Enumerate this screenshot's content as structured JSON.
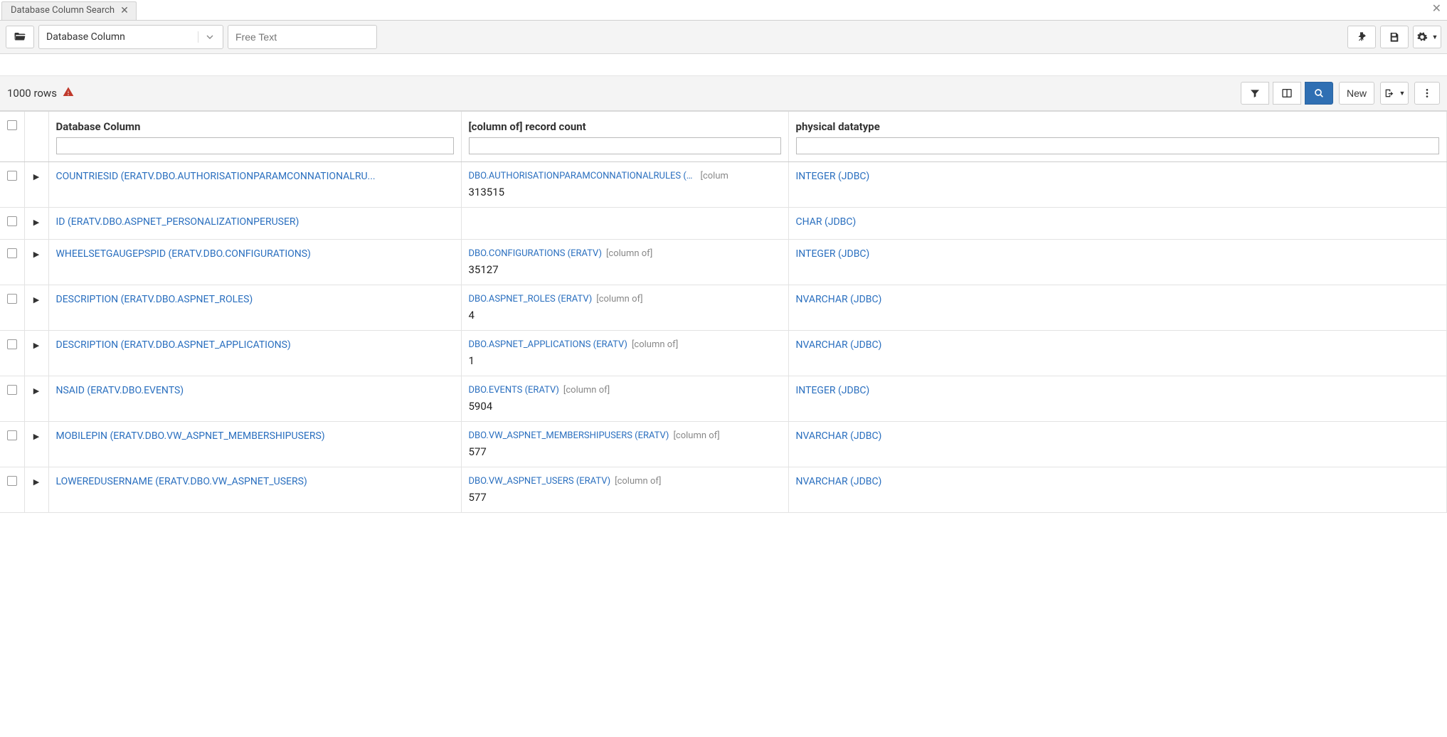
{
  "tab": {
    "title": "Database Column Search"
  },
  "toolbar": {
    "searchTypeSelected": "Database Column",
    "freeTextPlaceholder": "Free Text"
  },
  "results": {
    "rowCountLabel": "1000 rows",
    "newButtonLabel": "New"
  },
  "table": {
    "columns": {
      "dbColumn": "Database Column",
      "recordCount": "[column of] record count",
      "datatype": "physical datatype"
    },
    "rows": [
      {
        "dbColumn": "COUNTRIESID (ERATV.DBO.AUTHORISATIONPARAMCONNATIONALRU...",
        "recLink": "DBO.AUTHORISATIONPARAMCONNATIONALRULES (ERATV)",
        "recNote": "[colum",
        "count": "313515",
        "datatype": "INTEGER (JDBC)"
      },
      {
        "dbColumn": "ID (ERATV.DBO.ASPNET_PERSONALIZATIONPERUSER)",
        "recLink": "",
        "recNote": "",
        "count": "",
        "datatype": "CHAR (JDBC)"
      },
      {
        "dbColumn": "WHEELSETGAUGEPSPID (ERATV.DBO.CONFIGURATIONS)",
        "recLink": "DBO.CONFIGURATIONS (ERATV)",
        "recNote": "[column of]",
        "count": "35127",
        "datatype": "INTEGER (JDBC)"
      },
      {
        "dbColumn": "DESCRIPTION (ERATV.DBO.ASPNET_ROLES)",
        "recLink": "DBO.ASPNET_ROLES (ERATV)",
        "recNote": "[column of]",
        "count": "4",
        "datatype": "NVARCHAR (JDBC)"
      },
      {
        "dbColumn": "DESCRIPTION (ERATV.DBO.ASPNET_APPLICATIONS)",
        "recLink": "DBO.ASPNET_APPLICATIONS (ERATV)",
        "recNote": "[column of]",
        "count": "1",
        "datatype": "NVARCHAR (JDBC)"
      },
      {
        "dbColumn": "NSAID (ERATV.DBO.EVENTS)",
        "recLink": "DBO.EVENTS (ERATV)",
        "recNote": "[column of]",
        "count": "5904",
        "datatype": "INTEGER (JDBC)"
      },
      {
        "dbColumn": "MOBILEPIN (ERATV.DBO.VW_ASPNET_MEMBERSHIPUSERS)",
        "recLink": "DBO.VW_ASPNET_MEMBERSHIPUSERS (ERATV)",
        "recNote": "[column of]",
        "count": "577",
        "datatype": "NVARCHAR (JDBC)"
      },
      {
        "dbColumn": "LOWEREDUSERNAME (ERATV.DBO.VW_ASPNET_USERS)",
        "recLink": "DBO.VW_ASPNET_USERS (ERATV)",
        "recNote": "[column of]",
        "count": "577",
        "datatype": "NVARCHAR (JDBC)"
      }
    ]
  }
}
